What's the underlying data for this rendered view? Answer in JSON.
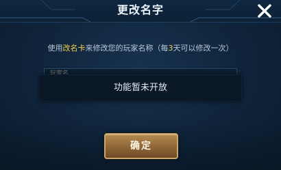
{
  "dialog": {
    "title": "更改名字",
    "close_icon": "close-icon"
  },
  "instruction": {
    "prefix": "使用",
    "item_name": "改名卡",
    "middle": "来修改您的玩家名称（每",
    "days": "3",
    "suffix": "天可以修改一次）"
  },
  "name_input": {
    "value": "",
    "placeholder": "玩家名"
  },
  "notice": {
    "text": "功能暂未开放"
  },
  "confirm_button": {
    "label": "确定"
  },
  "colors": {
    "highlight": "#f3d24a",
    "button_gold": "#b48a52",
    "background": "#10263d"
  }
}
